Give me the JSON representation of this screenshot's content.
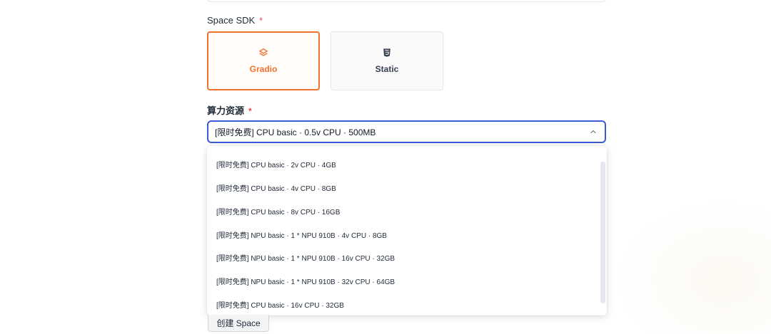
{
  "sdk_section": {
    "label": "Space SDK",
    "required_mark": "*",
    "options": [
      {
        "label": "Gradio",
        "icon": "gradio-icon",
        "selected": true
      },
      {
        "label": "Static",
        "icon": "html5-icon",
        "selected": false
      }
    ]
  },
  "compute_section": {
    "label": "算力资源",
    "required_mark": "*",
    "selected_value": "[限时免费] CPU basic · 0.5v CPU · 500MB",
    "options": [
      "[限时免费] CPU basic · 2v CPU · 4GB",
      "[限时免费] CPU basic · 4v CPU · 8GB",
      "[限时免费] CPU basic · 8v CPU · 16GB",
      "[限时免费] NPU basic · 1 * NPU 910B · 4v CPU · 8GB",
      "[限时免费] NPU basic · 1 * NPU 910B · 16v CPU · 32GB",
      "[限时免费] NPU basic · 1 * NPU 910B · 32v CPU · 64GB",
      "[限时免费] CPU basic · 16v CPU · 32GB"
    ]
  },
  "create_button": {
    "label": "创建 Space"
  },
  "colors": {
    "accent": "#f0722e",
    "focus": "#3b5bdb",
    "required": "#ef4444"
  }
}
